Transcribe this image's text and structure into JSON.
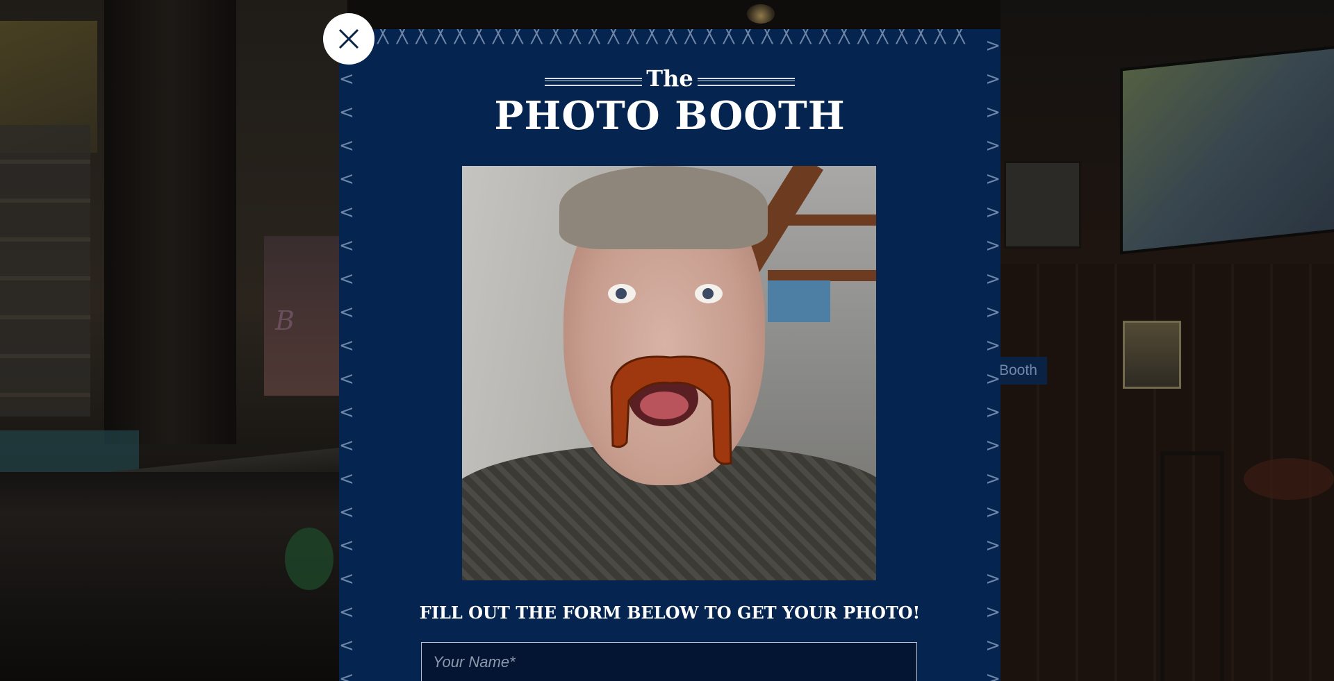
{
  "modal": {
    "title_small": "The",
    "title_main": "PHOTO BOOTH",
    "form_heading": "FILL OUT THE FORM BELOW TO GET YOUR PHOTO!",
    "name_field": {
      "placeholder": "Your Name*",
      "value": ""
    },
    "close_icon": "close-icon"
  },
  "background": {
    "label": "Booth"
  },
  "colors": {
    "modal_bg": "#052550",
    "input_bg": "#031533",
    "title_text": "#ffffff"
  }
}
